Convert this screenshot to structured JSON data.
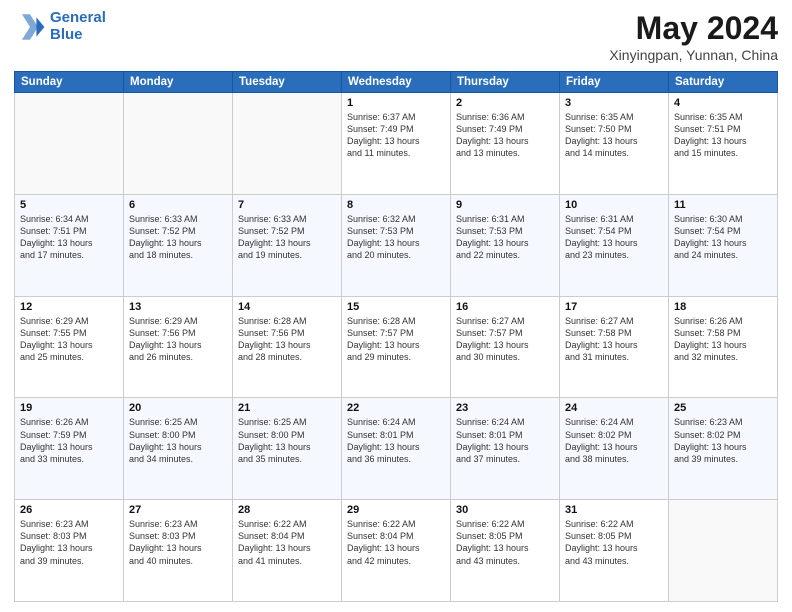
{
  "logo": {
    "line1": "General",
    "line2": "Blue"
  },
  "title": "May 2024",
  "subtitle": "Xinyingpan, Yunnan, China",
  "days_header": [
    "Sunday",
    "Monday",
    "Tuesday",
    "Wednesday",
    "Thursday",
    "Friday",
    "Saturday"
  ],
  "weeks": [
    [
      {
        "day": "",
        "info": ""
      },
      {
        "day": "",
        "info": ""
      },
      {
        "day": "",
        "info": ""
      },
      {
        "day": "1",
        "info": "Sunrise: 6:37 AM\nSunset: 7:49 PM\nDaylight: 13 hours\nand 11 minutes."
      },
      {
        "day": "2",
        "info": "Sunrise: 6:36 AM\nSunset: 7:49 PM\nDaylight: 13 hours\nand 13 minutes."
      },
      {
        "day": "3",
        "info": "Sunrise: 6:35 AM\nSunset: 7:50 PM\nDaylight: 13 hours\nand 14 minutes."
      },
      {
        "day": "4",
        "info": "Sunrise: 6:35 AM\nSunset: 7:51 PM\nDaylight: 13 hours\nand 15 minutes."
      }
    ],
    [
      {
        "day": "5",
        "info": "Sunrise: 6:34 AM\nSunset: 7:51 PM\nDaylight: 13 hours\nand 17 minutes."
      },
      {
        "day": "6",
        "info": "Sunrise: 6:33 AM\nSunset: 7:52 PM\nDaylight: 13 hours\nand 18 minutes."
      },
      {
        "day": "7",
        "info": "Sunrise: 6:33 AM\nSunset: 7:52 PM\nDaylight: 13 hours\nand 19 minutes."
      },
      {
        "day": "8",
        "info": "Sunrise: 6:32 AM\nSunset: 7:53 PM\nDaylight: 13 hours\nand 20 minutes."
      },
      {
        "day": "9",
        "info": "Sunrise: 6:31 AM\nSunset: 7:53 PM\nDaylight: 13 hours\nand 22 minutes."
      },
      {
        "day": "10",
        "info": "Sunrise: 6:31 AM\nSunset: 7:54 PM\nDaylight: 13 hours\nand 23 minutes."
      },
      {
        "day": "11",
        "info": "Sunrise: 6:30 AM\nSunset: 7:54 PM\nDaylight: 13 hours\nand 24 minutes."
      }
    ],
    [
      {
        "day": "12",
        "info": "Sunrise: 6:29 AM\nSunset: 7:55 PM\nDaylight: 13 hours\nand 25 minutes."
      },
      {
        "day": "13",
        "info": "Sunrise: 6:29 AM\nSunset: 7:56 PM\nDaylight: 13 hours\nand 26 minutes."
      },
      {
        "day": "14",
        "info": "Sunrise: 6:28 AM\nSunset: 7:56 PM\nDaylight: 13 hours\nand 28 minutes."
      },
      {
        "day": "15",
        "info": "Sunrise: 6:28 AM\nSunset: 7:57 PM\nDaylight: 13 hours\nand 29 minutes."
      },
      {
        "day": "16",
        "info": "Sunrise: 6:27 AM\nSunset: 7:57 PM\nDaylight: 13 hours\nand 30 minutes."
      },
      {
        "day": "17",
        "info": "Sunrise: 6:27 AM\nSunset: 7:58 PM\nDaylight: 13 hours\nand 31 minutes."
      },
      {
        "day": "18",
        "info": "Sunrise: 6:26 AM\nSunset: 7:58 PM\nDaylight: 13 hours\nand 32 minutes."
      }
    ],
    [
      {
        "day": "19",
        "info": "Sunrise: 6:26 AM\nSunset: 7:59 PM\nDaylight: 13 hours\nand 33 minutes."
      },
      {
        "day": "20",
        "info": "Sunrise: 6:25 AM\nSunset: 8:00 PM\nDaylight: 13 hours\nand 34 minutes."
      },
      {
        "day": "21",
        "info": "Sunrise: 6:25 AM\nSunset: 8:00 PM\nDaylight: 13 hours\nand 35 minutes."
      },
      {
        "day": "22",
        "info": "Sunrise: 6:24 AM\nSunset: 8:01 PM\nDaylight: 13 hours\nand 36 minutes."
      },
      {
        "day": "23",
        "info": "Sunrise: 6:24 AM\nSunset: 8:01 PM\nDaylight: 13 hours\nand 37 minutes."
      },
      {
        "day": "24",
        "info": "Sunrise: 6:24 AM\nSunset: 8:02 PM\nDaylight: 13 hours\nand 38 minutes."
      },
      {
        "day": "25",
        "info": "Sunrise: 6:23 AM\nSunset: 8:02 PM\nDaylight: 13 hours\nand 39 minutes."
      }
    ],
    [
      {
        "day": "26",
        "info": "Sunrise: 6:23 AM\nSunset: 8:03 PM\nDaylight: 13 hours\nand 39 minutes."
      },
      {
        "day": "27",
        "info": "Sunrise: 6:23 AM\nSunset: 8:03 PM\nDaylight: 13 hours\nand 40 minutes."
      },
      {
        "day": "28",
        "info": "Sunrise: 6:22 AM\nSunset: 8:04 PM\nDaylight: 13 hours\nand 41 minutes."
      },
      {
        "day": "29",
        "info": "Sunrise: 6:22 AM\nSunset: 8:04 PM\nDaylight: 13 hours\nand 42 minutes."
      },
      {
        "day": "30",
        "info": "Sunrise: 6:22 AM\nSunset: 8:05 PM\nDaylight: 13 hours\nand 43 minutes."
      },
      {
        "day": "31",
        "info": "Sunrise: 6:22 AM\nSunset: 8:05 PM\nDaylight: 13 hours\nand 43 minutes."
      },
      {
        "day": "",
        "info": ""
      }
    ]
  ]
}
